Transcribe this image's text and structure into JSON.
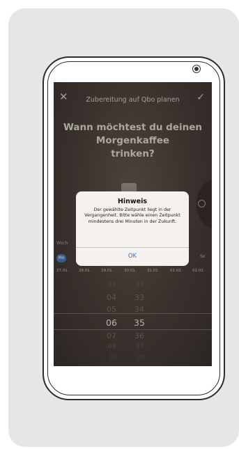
{
  "header": {
    "close_icon": "close-icon",
    "title": "Zubereitung auf Qbo planen",
    "confirm_icon": "checkmark-icon"
  },
  "question": [
    "Wann möchtest du deinen",
    "Morgenkaffee",
    "trinken?"
  ],
  "week_label": "Woch",
  "days": [
    {
      "label": "Mo",
      "date": "27.01.",
      "selected": true
    },
    {
      "label": "",
      "date": "28.01."
    },
    {
      "label": "",
      "date": "29.01."
    },
    {
      "label": "",
      "date": "30.01."
    },
    {
      "label": "",
      "date": "31.01."
    },
    {
      "label": "",
      "date": "01.02."
    },
    {
      "label": "So",
      "date": "02.02."
    }
  ],
  "picker": {
    "hours": [
      "03",
      "04",
      "05",
      "06",
      "07",
      "08",
      "09"
    ],
    "minutes": [
      "32",
      "33",
      "34",
      "35",
      "36",
      "37",
      "38"
    ],
    "selected_hour": "06",
    "selected_minute": "35"
  },
  "dialog": {
    "title": "Hinweis",
    "message": "Der gewählte Zeitpunkt liegt in der Vergangenheit. Bitte wähle einen Zeitpunkt mindestens drei Minuten in der Zukunft.",
    "ok_label": "OK"
  },
  "colors": {
    "accent": "#3e6fb3",
    "dialog_button": "#3a6fc4",
    "screen_bg": "#3f3631"
  }
}
